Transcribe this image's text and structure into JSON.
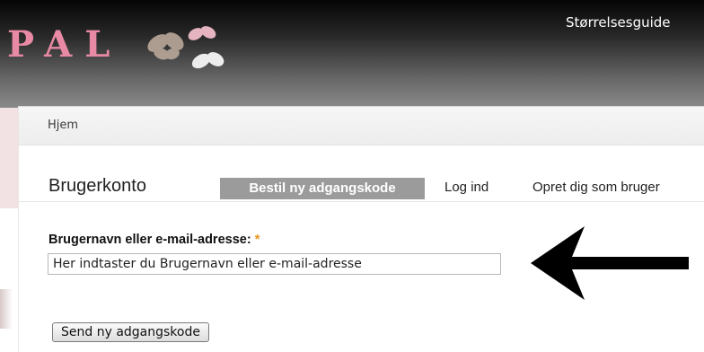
{
  "header": {
    "logo_text": "PAL",
    "size_guide_link": "Størrelsesguide"
  },
  "breadcrumb": {
    "home": "Hjem"
  },
  "page": {
    "title": "Brugerkonto"
  },
  "tabs": [
    {
      "label": "Bestil ny adgangskode",
      "active": true
    },
    {
      "label": "Log ind",
      "active": false
    },
    {
      "label": "Opret dig som bruger",
      "active": false
    }
  ],
  "form": {
    "username_label": "Brugernavn eller e-mail-adresse:",
    "required_marker": "*",
    "username_value": "Her indtaster du Brugernavn eller e-mail-adresse",
    "submit_label": "Send ny adgangskode"
  },
  "colors": {
    "logo": "#e98aa4",
    "active_tab": "#9b9b9b",
    "required": "#e8941a"
  },
  "icons": {
    "decoration": "butterflies-icon",
    "annotation": "arrow-left-icon"
  }
}
